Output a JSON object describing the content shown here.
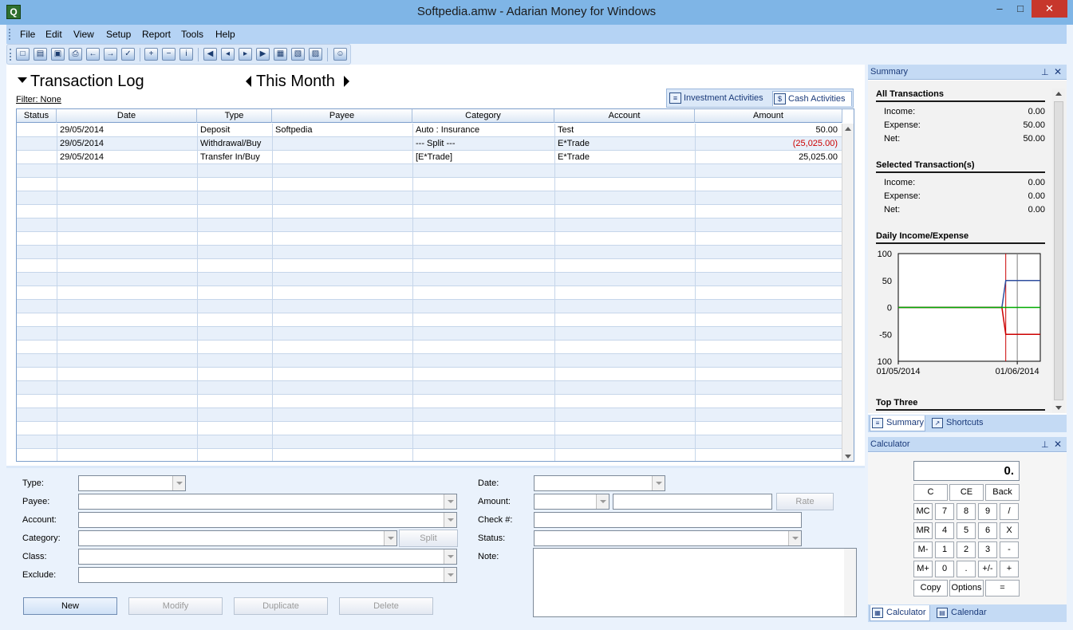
{
  "window": {
    "title": "Softpedia.amw - Adarian Money for Windows"
  },
  "menu": [
    "File",
    "Edit",
    "View",
    "Setup",
    "Report",
    "Tools",
    "Help"
  ],
  "toolbar": {
    "buttons": [
      "new-file",
      "open-file",
      "save",
      "print",
      "import",
      "export",
      "reconcile",
      "add",
      "remove",
      "info",
      "first",
      "previous",
      "next",
      "last",
      "new-window",
      "picture",
      "picture-edit",
      "user"
    ]
  },
  "log": {
    "title": "Transaction Log",
    "period": "This Month",
    "filter": "Filter: None",
    "tabs": [
      "Investment Activities",
      "Cash Activities"
    ]
  },
  "grid": {
    "columns": [
      "Status",
      "Date",
      "Type",
      "Payee",
      "Category",
      "Account",
      "Amount"
    ],
    "rows": [
      [
        "",
        "29/05/2014",
        "Deposit",
        "Softpedia",
        "Auto : Insurance",
        "Test",
        "50.00"
      ],
      [
        "",
        "29/05/2014",
        "Withdrawal/Buy",
        "",
        "--- Split ---",
        "E*Trade",
        "(25,025.00)"
      ],
      [
        "",
        "29/05/2014",
        "Transfer In/Buy",
        "",
        "[E*Trade]",
        "E*Trade",
        "25,025.00"
      ]
    ],
    "negative_color": "#cc0000"
  },
  "form": {
    "labels": {
      "type": "Type:",
      "payee": "Payee:",
      "account": "Account:",
      "category": "Category:",
      "class": "Class:",
      "exclude": "Exclude:",
      "date": "Date:",
      "amount": "Amount:",
      "check": "Check #:",
      "status": "Status:",
      "note": "Note:"
    },
    "buttons": {
      "split": "Split",
      "rate": "Rate",
      "new": "New",
      "modify": "Modify",
      "duplicate": "Duplicate",
      "delete": "Delete"
    }
  },
  "summary": {
    "title": "Summary",
    "all": {
      "title": "All Transactions",
      "income_label": "Income:",
      "income": "0.00",
      "expense_label": "Expense:",
      "expense": "50.00",
      "net_label": "Net:",
      "net": "50.00"
    },
    "selected": {
      "title": "Selected Transaction(s)",
      "income_label": "Income:",
      "income": "0.00",
      "expense_label": "Expense:",
      "expense": "0.00",
      "net_label": "Net:",
      "net": "0.00"
    },
    "daily_title": "Daily Income/Expense",
    "top_three_title": "Top Three",
    "tabs": [
      "Summary",
      "Shortcuts"
    ]
  },
  "chart_data": {
    "type": "line",
    "title": "Daily Income/Expense",
    "y_ticks": [
      "100",
      "50",
      "0",
      "-50",
      "100"
    ],
    "x_ticks": [
      "01/05/2014",
      "01/06/2014"
    ],
    "ylim": [
      -100,
      100
    ],
    "x_range": [
      "01/05/2014",
      "07/06/2014"
    ],
    "grid": false,
    "markers": [
      {
        "x": "29/05/2014",
        "color": "#cc0000"
      },
      {
        "x": "01/06/2014",
        "color": "#808080"
      }
    ],
    "series": [
      {
        "color": "#2f4f9f",
        "points": [
          [
            "01/05/2014",
            0
          ],
          [
            "28/05/2014",
            0
          ],
          [
            "29/05/2014",
            50
          ],
          [
            "07/06/2014",
            50
          ]
        ]
      },
      {
        "color": "#cc0000",
        "points": [
          [
            "01/05/2014",
            0
          ],
          [
            "28/05/2014",
            0
          ],
          [
            "29/05/2014",
            -50
          ],
          [
            "07/06/2014",
            -50
          ]
        ]
      },
      {
        "color": "#00aa00",
        "points": [
          [
            "01/05/2014",
            0
          ],
          [
            "07/06/2014",
            0
          ]
        ]
      }
    ]
  },
  "calculator": {
    "title": "Calculator",
    "display": "0.",
    "keys": [
      [
        "C",
        "CE",
        "Back"
      ],
      [
        "MC",
        "7",
        "8",
        "9",
        "/"
      ],
      [
        "MR",
        "4",
        "5",
        "6",
        "X"
      ],
      [
        "M-",
        "1",
        "2",
        "3",
        "-"
      ],
      [
        "M+",
        "0",
        ".",
        "+/-",
        "+"
      ],
      [
        "Copy",
        "Options",
        "="
      ]
    ],
    "tabs": [
      "Calculator",
      "Calendar"
    ]
  }
}
